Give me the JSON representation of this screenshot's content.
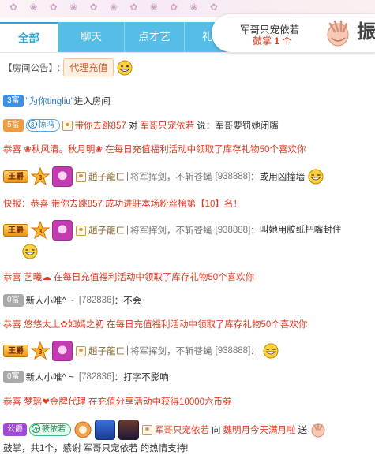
{
  "tabs": [
    {
      "label": "全部",
      "active": true
    },
    {
      "label": "聊天",
      "active": false
    },
    {
      "label": "点才艺",
      "active": false
    },
    {
      "label": "礼",
      "active": false
    }
  ],
  "gift_card": {
    "line1": "军哥只宠依若",
    "line2_prefix": "鼓掌",
    "line2_count": "1",
    "line2_suffix": "个",
    "big_char": "振"
  },
  "notice": {
    "prefix": "【房间公告】:",
    "tag": "代理充值"
  },
  "messages": [
    {
      "level": "3富",
      "name": "\"为你tingliu\"",
      "text": "进入房间"
    },
    {
      "level": "5富",
      "badge_num": "3",
      "badge": "惊鸿",
      "user": "带你去跳857",
      "mid": "对",
      "target": "军哥只宠依若",
      "say": "说：",
      "text": "军哥要罚她闭嘴"
    },
    {
      "text": "恭喜 ❀秋风清。秋月明❀ 在每日充值福利活动中领取了库存礼物50个喜欢你"
    },
    {
      "rank": "王爵",
      "star": "3",
      "user": "趙子龍ㄈ",
      "sep": "|",
      "title": "将军挥剑，不斩苍蝇",
      "id": "[938888]",
      "colon": "：",
      "text": "或用凶撞墙"
    },
    {
      "text": "快报：恭喜 带你去跳857 成功进驻本场粉丝榜第【10】名！"
    },
    {
      "rank": "王爵",
      "star": "3",
      "user": "趙子龍ㄈ",
      "sep": "|",
      "title": "将军挥剑，不斩苍蝇",
      "id": "[938888]",
      "colon": "：",
      "text": "叫她用胶纸把嘴封住"
    },
    {
      "text": "恭喜 艺曦☁ 在每日充值福利活动中领取了库存礼物50个喜欢你"
    },
    {
      "level": "0富",
      "user": "新人小唯^ ~",
      "id": "[782836]",
      "colon": "：",
      "text": "不会"
    },
    {
      "text": "恭喜 悠悠太上✿如嫣之初 在每日充值福利活动中领取了库存礼物50个喜欢你"
    },
    {
      "rank": "王爵",
      "star": "3",
      "user": "趙子龍ㄈ",
      "sep": "|",
      "title": "将军挥剑，不斩苍蝇",
      "id": "[938888]",
      "colon": "："
    },
    {
      "level": "0富",
      "user": "新人小唯^ ~",
      "id": "[782836]",
      "colon": "：",
      "text": "打字不影响"
    },
    {
      "text": "恭喜 梦瑶❤金牌代理 在充值分享活动中获得10000六币券"
    },
    {
      "rank": "公爵",
      "badge_num": "26",
      "badge": "筱依若",
      "user": "军哥只宠依若",
      "mid": "向",
      "target": "魏明月今天满月啦",
      "text": "送"
    }
  ],
  "footer_line": "鼓掌，共1个，感谢 军哥只宠依若 的热情支持!"
}
